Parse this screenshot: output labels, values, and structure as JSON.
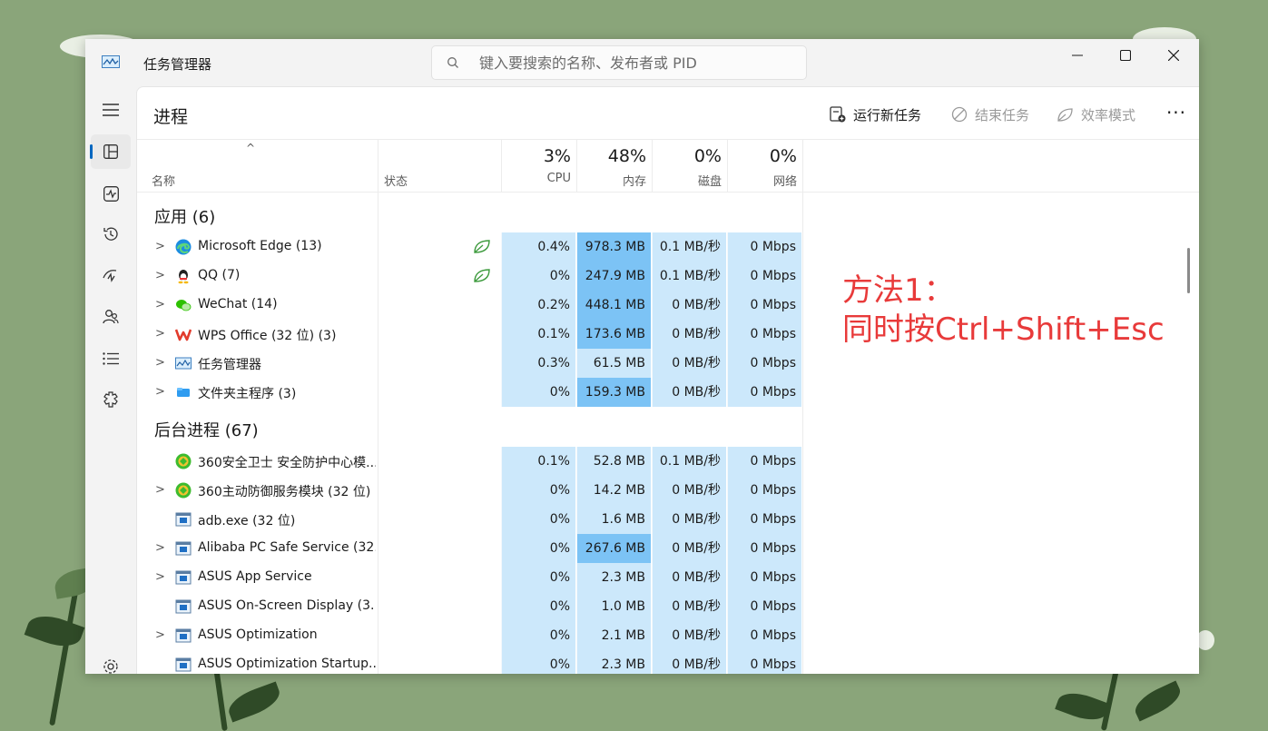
{
  "window": {
    "title": "任务管理器"
  },
  "search": {
    "placeholder": "键入要搜索的名称、发布者或 PID"
  },
  "colors": {
    "accent": "#0067c0",
    "heat_light": "#cce8fb",
    "heat_mid": "#a8d6f8",
    "heat_dark": "#7cc3f5",
    "annotation": "#e83a3a"
  },
  "sidebar": {
    "items": [
      {
        "icon": "hamburger-icon",
        "active": false
      },
      {
        "icon": "processes-icon",
        "active": true
      },
      {
        "icon": "performance-icon",
        "active": false
      },
      {
        "icon": "app-history-icon",
        "active": false
      },
      {
        "icon": "startup-apps-icon",
        "active": false
      },
      {
        "icon": "users-icon",
        "active": false
      },
      {
        "icon": "details-icon",
        "active": false
      },
      {
        "icon": "services-icon",
        "active": false
      },
      {
        "icon": "settings-icon",
        "active": false
      }
    ]
  },
  "toolbar": {
    "page_title": "进程",
    "run_new_task": "运行新任务",
    "end_task": "结束任务",
    "efficiency_mode": "效率模式",
    "more": "···"
  },
  "header": {
    "name": "名称",
    "status": "状态",
    "cpu_pct": "3%",
    "cpu": "CPU",
    "mem_pct": "48%",
    "mem": "内存",
    "disk_pct": "0%",
    "disk": "磁盘",
    "net_pct": "0%",
    "net": "网络"
  },
  "apps": {
    "title": "应用 (6)",
    "rows": [
      {
        "name": "Microsoft Edge (13)",
        "expandable": true,
        "icon": "edge-icon",
        "efficiency": true,
        "cpu": "0.4%",
        "mem": "978.3 MB",
        "disk": "0.1 MB/秒",
        "net": "0 Mbps",
        "mem_level": "dark",
        "cpu_level": "light"
      },
      {
        "name": "QQ (7)",
        "expandable": true,
        "icon": "qq-icon",
        "efficiency": true,
        "cpu": "0%",
        "mem": "247.9 MB",
        "disk": "0.1 MB/秒",
        "net": "0 Mbps",
        "mem_level": "dark",
        "cpu_level": "light"
      },
      {
        "name": "WeChat (14)",
        "expandable": true,
        "icon": "wechat-icon",
        "efficiency": false,
        "cpu": "0.2%",
        "mem": "448.1 MB",
        "disk": "0 MB/秒",
        "net": "0 Mbps",
        "mem_level": "dark",
        "cpu_level": "light"
      },
      {
        "name": "WPS Office (32 位) (3)",
        "expandable": true,
        "icon": "wps-icon",
        "efficiency": false,
        "cpu": "0.1%",
        "mem": "173.6 MB",
        "disk": "0 MB/秒",
        "net": "0 Mbps",
        "mem_level": "dark",
        "cpu_level": "light"
      },
      {
        "name": "任务管理器",
        "expandable": true,
        "icon": "task-manager-icon",
        "efficiency": false,
        "cpu": "0.3%",
        "mem": "61.5 MB",
        "disk": "0 MB/秒",
        "net": "0 Mbps",
        "mem_level": "light",
        "cpu_level": "light"
      },
      {
        "name": "文件夹主程序 (3)",
        "expandable": true,
        "icon": "folder-app-icon",
        "efficiency": false,
        "cpu": "0%",
        "mem": "159.3 MB",
        "disk": "0 MB/秒",
        "net": "0 Mbps",
        "mem_level": "dark",
        "cpu_level": "light"
      }
    ]
  },
  "background": {
    "title": "后台进程 (67)",
    "rows": [
      {
        "name": "360安全卫士 安全防护中心模...",
        "expandable": false,
        "icon": "360-icon",
        "efficiency": false,
        "cpu": "0.1%",
        "mem": "52.8 MB",
        "disk": "0.1 MB/秒",
        "net": "0 Mbps",
        "mem_level": "light",
        "cpu_level": "light"
      },
      {
        "name": "360主动防御服务模块 (32 位)",
        "expandable": true,
        "icon": "360-icon",
        "efficiency": false,
        "cpu": "0%",
        "mem": "14.2 MB",
        "disk": "0 MB/秒",
        "net": "0 Mbps",
        "mem_level": "light",
        "cpu_level": "light"
      },
      {
        "name": "adb.exe (32 位)",
        "expandable": false,
        "icon": "window-app-icon",
        "efficiency": false,
        "cpu": "0%",
        "mem": "1.6 MB",
        "disk": "0 MB/秒",
        "net": "0 Mbps",
        "mem_level": "light",
        "cpu_level": "light"
      },
      {
        "name": "Alibaba PC Safe Service (32...",
        "expandable": true,
        "icon": "window-app-icon",
        "efficiency": false,
        "cpu": "0%",
        "mem": "267.6 MB",
        "disk": "0 MB/秒",
        "net": "0 Mbps",
        "mem_level": "dark",
        "cpu_level": "light"
      },
      {
        "name": "ASUS App Service",
        "expandable": true,
        "icon": "window-app-icon",
        "efficiency": false,
        "cpu": "0%",
        "mem": "2.3 MB",
        "disk": "0 MB/秒",
        "net": "0 Mbps",
        "mem_level": "light",
        "cpu_level": "light"
      },
      {
        "name": "ASUS On-Screen Display (3...",
        "expandable": false,
        "icon": "window-app-icon",
        "efficiency": false,
        "cpu": "0%",
        "mem": "1.0 MB",
        "disk": "0 MB/秒",
        "net": "0 Mbps",
        "mem_level": "light",
        "cpu_level": "light"
      },
      {
        "name": "ASUS Optimization",
        "expandable": true,
        "icon": "window-app-icon",
        "efficiency": false,
        "cpu": "0%",
        "mem": "2.1 MB",
        "disk": "0 MB/秒",
        "net": "0 Mbps",
        "mem_level": "light",
        "cpu_level": "light"
      },
      {
        "name": "ASUS Optimization Startup...",
        "expandable": false,
        "icon": "window-app-icon",
        "efficiency": false,
        "cpu": "0%",
        "mem": "2.3 MB",
        "disk": "0 MB/秒",
        "net": "0 Mbps",
        "mem_level": "light",
        "cpu_level": "light"
      }
    ]
  },
  "annotation": {
    "line1": "方法1：",
    "line2": "同时按Ctrl+Shift+Esc"
  }
}
